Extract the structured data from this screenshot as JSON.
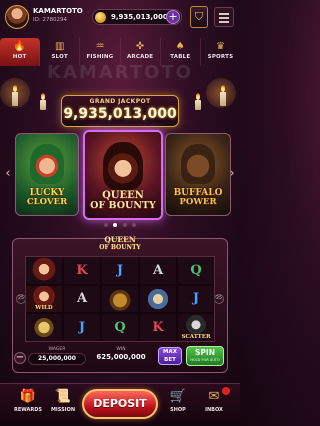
{
  "user": {
    "name": "KAMARTOTO",
    "id": "ID: 2780294"
  },
  "balance": {
    "amount": "9,935,013,000"
  },
  "header": {
    "add_label": "+",
    "shield_label": "⛉"
  },
  "tabs": [
    {
      "label": "HOT",
      "icon": "fire-icon",
      "glyph": "🔥",
      "active": true
    },
    {
      "label": "SLOT",
      "icon": "slot-icon",
      "glyph": "▥",
      "active": false
    },
    {
      "label": "FISHING",
      "icon": "fish-icon",
      "glyph": "♒",
      "active": false
    },
    {
      "label": "ARCADE",
      "icon": "gamepad-icon",
      "glyph": "✜",
      "active": false
    },
    {
      "label": "TABLE",
      "icon": "cards-icon",
      "glyph": "♠",
      "active": false
    },
    {
      "label": "SPORTS",
      "icon": "trophy-icon",
      "glyph": "♛",
      "active": false
    }
  ],
  "watermark": "KAMARTOTO",
  "jackpot": {
    "title": "GRAND JACKPOT",
    "value": "9,935,013,000"
  },
  "games": [
    {
      "line1": "LUCKY",
      "line2": "CLOVER"
    },
    {
      "line1": "QUEEN",
      "line2": "OF BOUNTY"
    },
    {
      "line1": "BUFFALO",
      "line2": "POWER"
    }
  ],
  "carousel": {
    "prev": "‹",
    "next": "›",
    "pages": 4,
    "current": 1
  },
  "slot": {
    "title_line1": "QUEEN",
    "title_line2": "OF BOUNTY",
    "reels": [
      [
        "",
        "K",
        "J",
        "A",
        "Q"
      ],
      [
        "WILD",
        "A",
        "",
        "",
        "J"
      ],
      [
        "",
        "J",
        "Q",
        "K",
        "SCATTER"
      ]
    ],
    "side_left": "25",
    "side_right": "25",
    "wager_label": "WAGER",
    "wager_value": "25,000,000",
    "win_label": "WIN",
    "win_value": "625,000,000",
    "maxbet_line1": "MAX",
    "maxbet_line2": "BET",
    "spin_label": "SPIN",
    "spin_sub": "HOLD FOR AUTO",
    "minus": "−"
  },
  "nav": [
    {
      "label": "REWARDS",
      "icon": "gift-icon",
      "glyph": "🎁"
    },
    {
      "label": "MISSION",
      "icon": "scroll-icon",
      "glyph": "📜"
    },
    {
      "label": "SHOP",
      "icon": "cart-icon",
      "glyph": "🛒"
    },
    {
      "label": "INBOX",
      "icon": "mail-icon",
      "glyph": "✉"
    }
  ],
  "deposit_label": "DEPOSIT",
  "colors": {
    "accent": "#d9a441",
    "active_tab": "#c2332a",
    "spin": "#52c64a",
    "deposit": "#c0141e",
    "highlight": "#d76cf2"
  }
}
